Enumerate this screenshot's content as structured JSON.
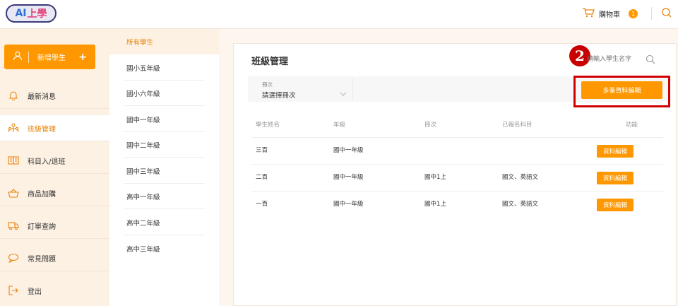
{
  "app": {
    "logo_ai": "AI",
    "logo_rest": "上學"
  },
  "header": {
    "cart_label": "購物車",
    "cart_count": "1"
  },
  "sidebar": {
    "add_student_label": "新增學生",
    "add_student_plus": "+",
    "items": [
      {
        "label": "最新消息",
        "icon": "bell-icon"
      },
      {
        "label": "班級管理",
        "icon": "class-group-icon"
      },
      {
        "label": "科目入/退班",
        "icon": "book-icon"
      },
      {
        "label": "商品加購",
        "icon": "basket-icon"
      },
      {
        "label": "訂單查詢",
        "icon": "truck-icon"
      },
      {
        "label": "常見問題",
        "icon": "chat-bubble-icon"
      },
      {
        "label": "登出",
        "icon": "logout-icon"
      }
    ]
  },
  "grades": [
    "所有學生",
    "國小五年級",
    "國小六年級",
    "國中一年級",
    "國中二年級",
    "國中三年級",
    "高中一年級",
    "高中二年級",
    "高中三年級"
  ],
  "main": {
    "title": "班級管理",
    "search_placeholder": "請輸入學生名字",
    "volume_select": {
      "label": "冊次",
      "value": "請選擇冊次"
    },
    "multi_edit_label": "多筆資料編輯",
    "step_number": "2"
  },
  "table": {
    "headers": [
      "學生姓名",
      "年級",
      "冊次",
      "已報名科目",
      "功能"
    ],
    "rows": [
      {
        "name": "三百",
        "grade": "國中一年級",
        "volume": "",
        "subjects": "",
        "action": "資料編輯"
      },
      {
        "name": "二百",
        "grade": "國中一年級",
        "volume": "國中1上",
        "subjects": "國文、英語文",
        "action": "資料編輯"
      },
      {
        "name": "一百",
        "grade": "國中一年級",
        "volume": "國中1上",
        "subjects": "國文、英語文",
        "action": "資料編輯"
      }
    ]
  },
  "colors": {
    "accent": "#ff9800",
    "active_text": "#e8830a",
    "highlight": "#d00000",
    "sidebar_bg": "#fdf1e3"
  }
}
